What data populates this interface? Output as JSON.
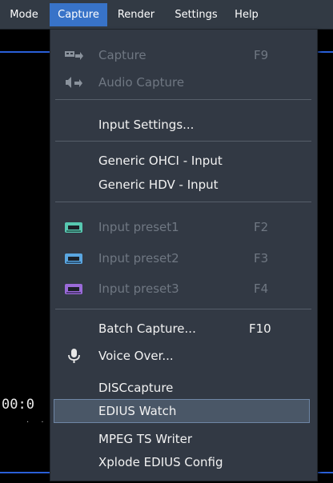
{
  "menubar": {
    "items": [
      {
        "label": "Mode"
      },
      {
        "label": "Capture"
      },
      {
        "label": "Render"
      },
      {
        "label": "Settings"
      },
      {
        "label": "Help"
      }
    ]
  },
  "background": {
    "timecode": "00:0",
    "dots": ". ."
  },
  "capture_menu": {
    "items": [
      {
        "label": "Capture",
        "shortcut": "F9",
        "enabled": false,
        "icon": "tape-capture-icon"
      },
      {
        "label": "Audio Capture",
        "enabled": false,
        "icon": "speaker-capture-icon"
      },
      {
        "label": "Input Settings..."
      },
      {
        "label": "Generic OHCI - Input"
      },
      {
        "label": "Generic HDV - Input"
      },
      {
        "label": "Input preset1",
        "shortcut": "F2",
        "enabled": false,
        "icon": "cassette-icon"
      },
      {
        "label": "Input preset2",
        "shortcut": "F3",
        "enabled": false,
        "icon": "cassette-icon"
      },
      {
        "label": "Input preset3",
        "shortcut": "F4",
        "enabled": false,
        "icon": "cassette-icon"
      },
      {
        "label": "Batch Capture...",
        "shortcut": "F10"
      },
      {
        "label": "Voice Over...",
        "icon": "microphone-icon"
      },
      {
        "label": "DISCcapture"
      },
      {
        "label": "EDIUS Watch",
        "highlighted": true
      },
      {
        "label": "MPEG TS Writer"
      },
      {
        "label": "Xplode EDIUS Config"
      }
    ]
  },
  "colors": {
    "accent": "#3873c8",
    "menu_bg": "#323944",
    "disabled_text": "#6f7782",
    "highlight_bg": "#4a5767",
    "cassette_1": "#57c7b0",
    "cassette_2": "#5aa6e0",
    "cassette_3": "#9a6ad8"
  }
}
